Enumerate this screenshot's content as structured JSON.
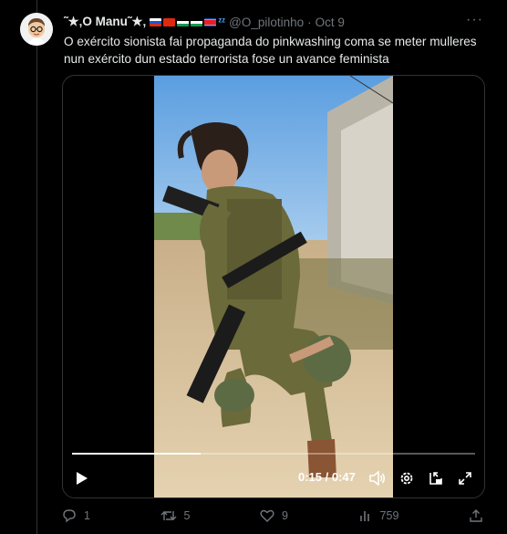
{
  "tweet": {
    "author_name": "˜★‚O Manu˜★‚",
    "handle": "@O_pilotinho",
    "separator": "·",
    "date": "Oct 9",
    "more": "···",
    "text": "O exército sionista fai propaganda do pinkwashing coma se meter mulleres nun exército dun estado terrorista fose un avance feminista",
    "flags": [
      "russia-flag",
      "china-flag",
      "palestine-flag",
      "palestine-flag",
      "north-korea-flag"
    ],
    "sleep_icon": "ᶻᶻ"
  },
  "video": {
    "current_time": "0:15",
    "duration": "0:47",
    "time_display": "0:15 / 0:47",
    "progress": 0.32
  },
  "actions": {
    "replies": "1",
    "reposts": "5",
    "likes": "9",
    "views": "759"
  }
}
